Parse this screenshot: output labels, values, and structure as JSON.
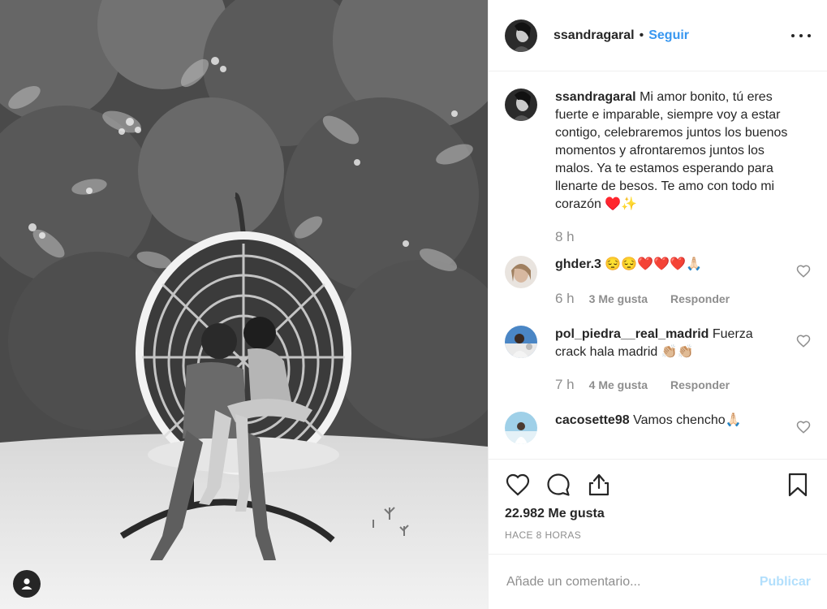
{
  "post": {
    "username": "ssandragaral",
    "follow_separator": "•",
    "follow_label": "Seguir"
  },
  "caption": {
    "username": "ssandragaral",
    "text": "Mi amor bonito, tú eres fuerte e imparable, siempre voy a estar contigo, celebraremos juntos los buenos momentos y afrontaremos juntos los malos. Ya te estamos esperando para llenarte de besos. Te amo con todo mi corazón ♥️✨",
    "time": "8 h"
  },
  "comments": [
    {
      "username": "ghder.3",
      "text": "😔😔❤️❤️❤️🙏🏻",
      "time": "6 h",
      "likes": "3 Me gusta",
      "reply": "Responder"
    },
    {
      "username": "pol_piedra__real_madrid",
      "text": "Fuerza crack hala madrid 👏🏼👏🏼",
      "time": "7 h",
      "likes": "4 Me gusta",
      "reply": "Responder"
    },
    {
      "username": "cacosette98",
      "text": "Vamos chencho🙏🏻"
    }
  ],
  "actions": {
    "likes_count": "22.982 Me gusta",
    "time_ago": "HACE 8 HORAS"
  },
  "add_comment": {
    "placeholder": "Añade un comentario...",
    "publish_label": "Publicar"
  },
  "colors": {
    "link_blue": "#3897f0",
    "publish_disabled": "#b2dffc",
    "muted_text": "#8e8e8e",
    "divider": "#efefef"
  },
  "icons": [
    "user-tag-icon",
    "more-options-icon",
    "heart-icon",
    "comment-icon",
    "share-icon",
    "bookmark-icon"
  ]
}
